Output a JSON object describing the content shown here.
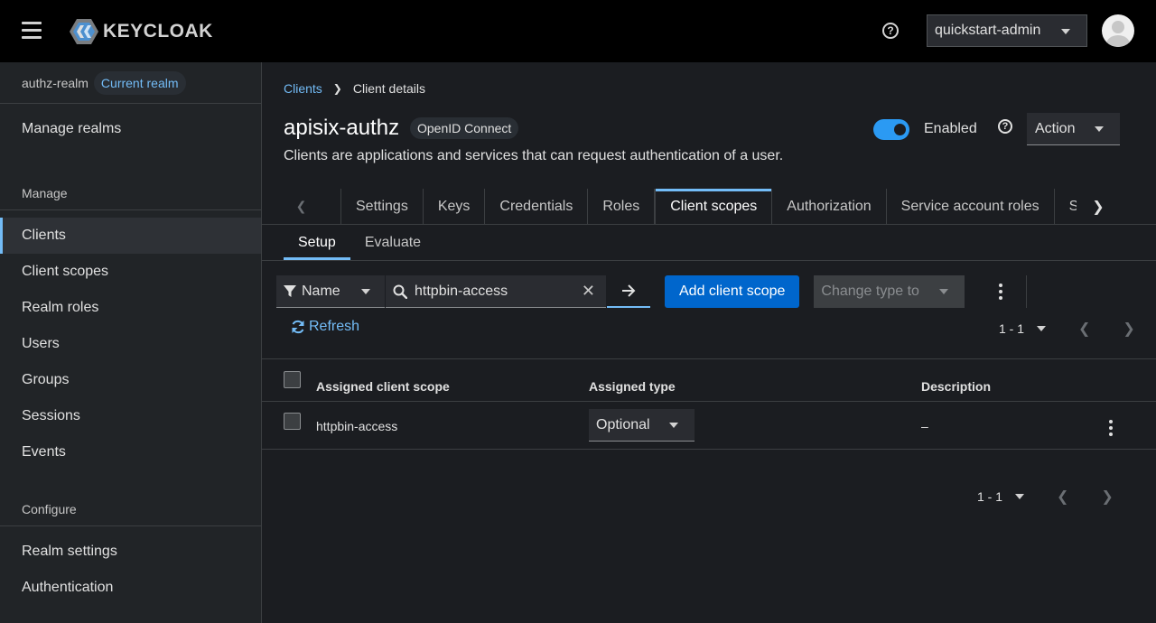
{
  "header": {
    "logo_text": "KEYCLOAK",
    "help_symbol": "?",
    "user": "quickstart-admin"
  },
  "sidebar": {
    "realm_name": "authz-realm",
    "realm_badge": "Current realm",
    "manage_realms": "Manage realms",
    "section_manage": "Manage",
    "manage_items": [
      "Clients",
      "Client scopes",
      "Realm roles",
      "Users",
      "Groups",
      "Sessions",
      "Events"
    ],
    "active_item": "Clients",
    "section_configure": "Configure",
    "configure_items": [
      "Realm settings",
      "Authentication"
    ]
  },
  "breadcrumb": {
    "parent": "Clients",
    "current": "Client details"
  },
  "client": {
    "name": "apisix-authz",
    "protocol_badge": "OpenID Connect",
    "description": "Clients are applications and services that can request authentication of a user.",
    "enabled_label": "Enabled",
    "enabled": true,
    "action_label": "Action"
  },
  "tabs": [
    "Settings",
    "Keys",
    "Credentials",
    "Roles",
    "Client scopes",
    "Authorization",
    "Service account roles",
    "Se"
  ],
  "active_tab": "Client scopes",
  "subtabs": [
    "Setup",
    "Evaluate"
  ],
  "active_subtab": "Setup",
  "toolbar": {
    "filter_label": "Name",
    "search_value": "httpbin-access",
    "add_button": "Add client scope",
    "change_type": "Change type to",
    "refresh": "Refresh"
  },
  "pagination": {
    "range": "1 - 1"
  },
  "table": {
    "columns": [
      "Assigned client scope",
      "Assigned type",
      "Description"
    ],
    "rows": [
      {
        "scope": "httpbin-access",
        "type": "Optional",
        "description": "–"
      }
    ]
  },
  "colors": {
    "accent": "#73bcf7",
    "primary": "#0066cc",
    "toggle_on": "#2b9af3"
  }
}
